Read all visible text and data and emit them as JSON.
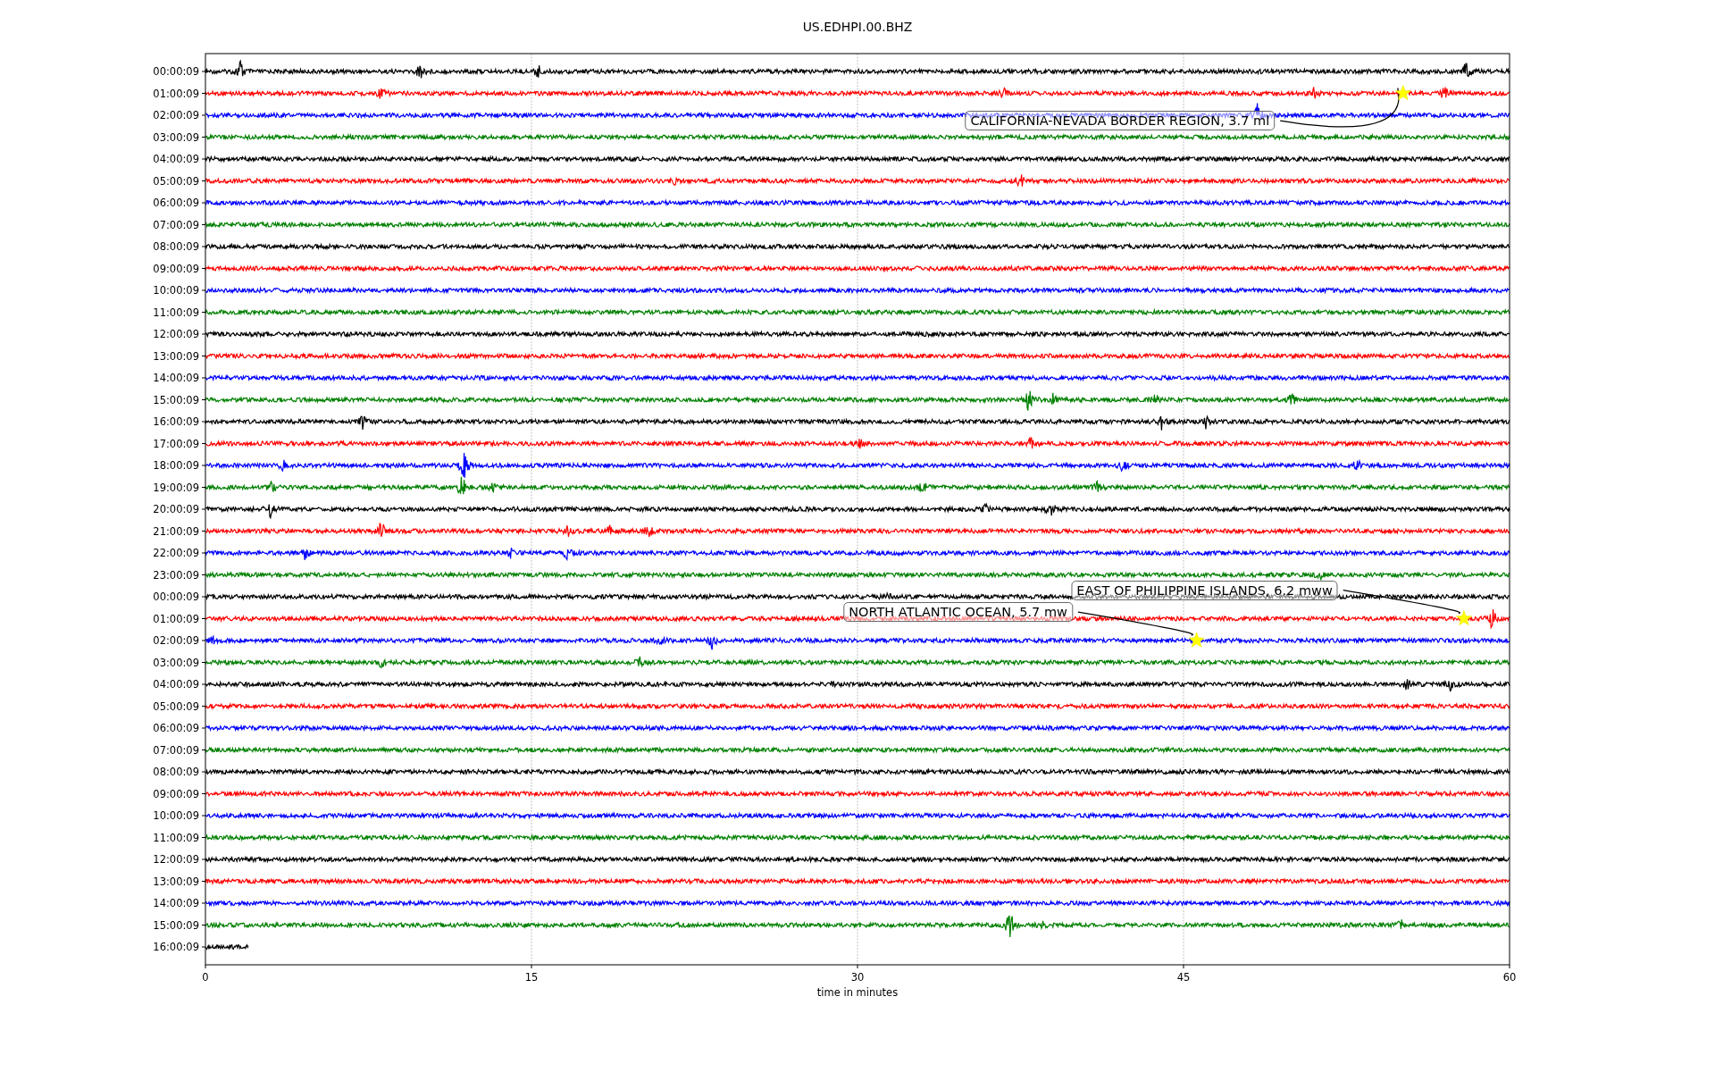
{
  "plot": {
    "title": "US.EDHPI.00.BHZ",
    "xlabel": "time in minutes",
    "xticks": [
      "0",
      "15",
      "30",
      "45",
      "60"
    ],
    "rows": [
      {
        "label": "00:00:09",
        "color": "#000000"
      },
      {
        "label": "01:00:09",
        "color": "#ff0000"
      },
      {
        "label": "02:00:09",
        "color": "#0000ff"
      },
      {
        "label": "03:00:09",
        "color": "#008000"
      },
      {
        "label": "04:00:09",
        "color": "#000000"
      },
      {
        "label": "05:00:09",
        "color": "#ff0000"
      },
      {
        "label": "06:00:09",
        "color": "#0000ff"
      },
      {
        "label": "07:00:09",
        "color": "#008000"
      },
      {
        "label": "08:00:09",
        "color": "#000000"
      },
      {
        "label": "09:00:09",
        "color": "#ff0000"
      },
      {
        "label": "10:00:09",
        "color": "#0000ff"
      },
      {
        "label": "11:00:09",
        "color": "#008000"
      },
      {
        "label": "12:00:09",
        "color": "#000000"
      },
      {
        "label": "13:00:09",
        "color": "#ff0000"
      },
      {
        "label": "14:00:09",
        "color": "#0000ff"
      },
      {
        "label": "15:00:09",
        "color": "#008000"
      },
      {
        "label": "16:00:09",
        "color": "#000000"
      },
      {
        "label": "17:00:09",
        "color": "#ff0000"
      },
      {
        "label": "18:00:09",
        "color": "#0000ff"
      },
      {
        "label": "19:00:09",
        "color": "#008000"
      },
      {
        "label": "20:00:09",
        "color": "#000000"
      },
      {
        "label": "21:00:09",
        "color": "#ff0000"
      },
      {
        "label": "22:00:09",
        "color": "#0000ff"
      },
      {
        "label": "23:00:09",
        "color": "#008000"
      },
      {
        "label": "00:00:09",
        "color": "#000000"
      },
      {
        "label": "01:00:09",
        "color": "#ff0000"
      },
      {
        "label": "02:00:09",
        "color": "#0000ff"
      },
      {
        "label": "03:00:09",
        "color": "#008000"
      },
      {
        "label": "04:00:09",
        "color": "#000000"
      },
      {
        "label": "05:00:09",
        "color": "#ff0000"
      },
      {
        "label": "06:00:09",
        "color": "#0000ff"
      },
      {
        "label": "07:00:09",
        "color": "#008000"
      },
      {
        "label": "08:00:09",
        "color": "#000000"
      },
      {
        "label": "09:00:09",
        "color": "#ff0000"
      },
      {
        "label": "10:00:09",
        "color": "#0000ff"
      },
      {
        "label": "11:00:09",
        "color": "#008000"
      },
      {
        "label": "12:00:09",
        "color": "#000000"
      },
      {
        "label": "13:00:09",
        "color": "#ff0000"
      },
      {
        "label": "14:00:09",
        "color": "#0000ff"
      },
      {
        "label": "15:00:09",
        "color": "#008000"
      },
      {
        "label": "16:00:09",
        "color": "#000000"
      }
    ],
    "events": [
      {
        "label": "CALIFORNIA-NEVADA BORDER REGION, 3.7 ml"
      },
      {
        "label": "EAST OF PHILIPPINE ISLANDS, 6.2 mww"
      },
      {
        "label": "NORTH ATLANTIC OCEAN, 5.7 mw"
      }
    ]
  }
}
